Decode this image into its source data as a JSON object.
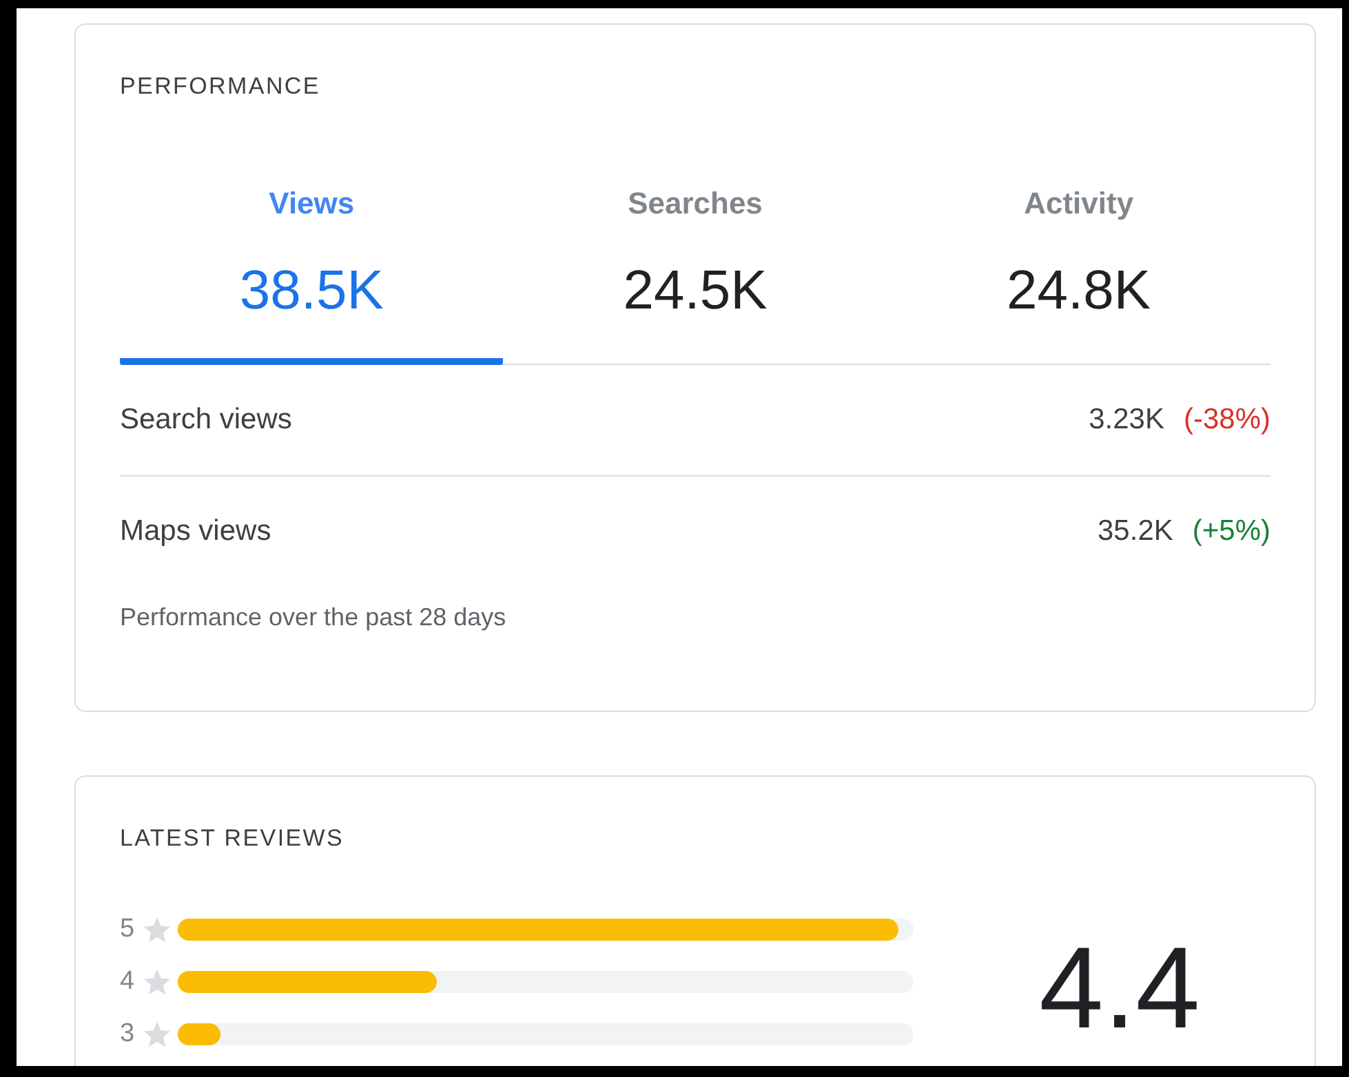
{
  "performance": {
    "title": "PERFORMANCE",
    "tabs": [
      {
        "label": "Views",
        "value": "38.5K",
        "selected": true
      },
      {
        "label": "Searches",
        "value": "24.5K",
        "selected": false
      },
      {
        "label": "Activity",
        "value": "24.8K",
        "selected": false
      }
    ],
    "rows": [
      {
        "label": "Search views",
        "value": "3.23K",
        "change": "(-38%)",
        "color": "#d93025"
      },
      {
        "label": "Maps views",
        "value": "35.2K",
        "change": "(+5%)",
        "color": "#188038"
      }
    ],
    "footnote": "Performance over the past 28 days"
  },
  "reviews": {
    "title": "LATEST REVIEWS",
    "bars": [
      {
        "stars_label": "5",
        "level": 1.0
      },
      {
        "stars_label": "4",
        "level": 0.36
      },
      {
        "stars_label": "3",
        "level": 0.06
      }
    ],
    "rating": "4.4"
  }
}
